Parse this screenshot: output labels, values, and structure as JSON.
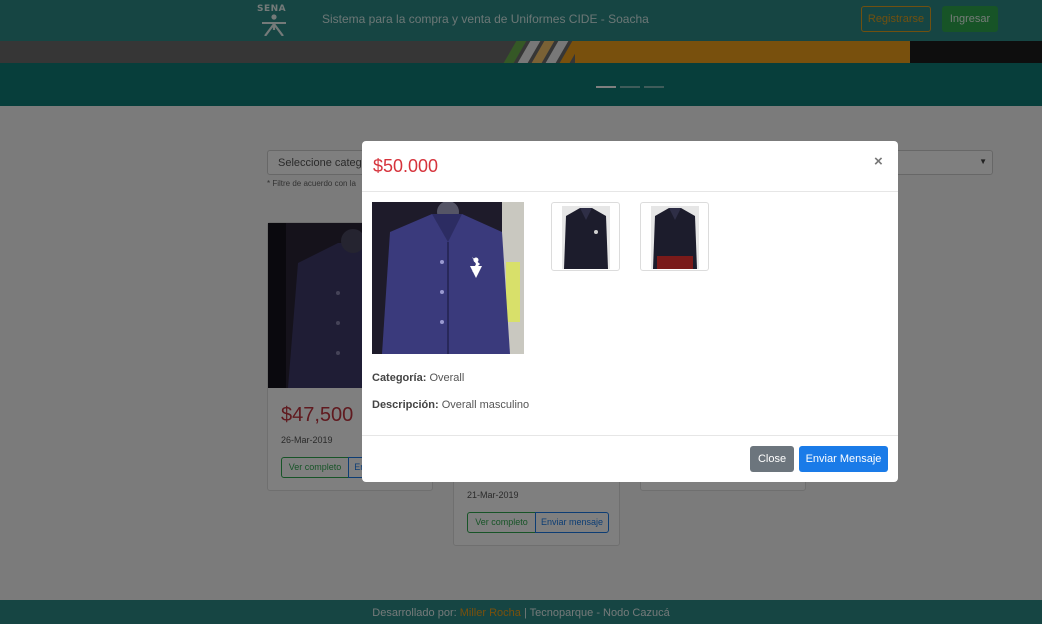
{
  "navbar": {
    "logo_text": "SENA",
    "title": "Sistema para la compra y venta de Uniformes CIDE - Soacha",
    "register_label": "Registrarse",
    "login_label": "Ingresar"
  },
  "filters": {
    "category_select_value": "Seleccione categ",
    "hint": "* Filtre de acuerdo con la"
  },
  "products": [
    {
      "price": "$47,500",
      "date": "26-Mar-2019",
      "view_label": "Ver completo",
      "message_label": "Envi"
    },
    {
      "date": "21-Mar-2019",
      "view_label": "Ver completo",
      "message_label": "Enviar mensaje"
    }
  ],
  "modal": {
    "price": "$50.000",
    "close_icon": "×",
    "category_label": "Categoría:",
    "category_value": "Overall",
    "description_label": "Descripción:",
    "description_value": "Overall masculino",
    "close_button": "Close",
    "send_button": "Enviar Mensaje"
  },
  "footer": {
    "prefix": "Desarrollado por:",
    "author": "Miller Rocha",
    "suffix": "| Tecnoparque - Nodo Cazucá"
  },
  "colors": {
    "brand_teal": "#2c8a86",
    "price_red": "#d6333c",
    "primary_blue": "#1a7be8",
    "accent_orange": "#f0a01a"
  }
}
